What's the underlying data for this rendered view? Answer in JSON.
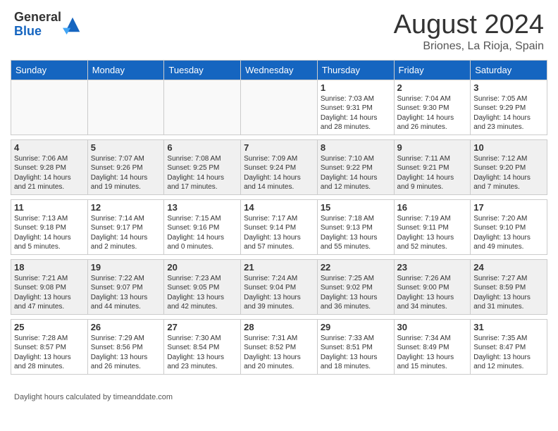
{
  "header": {
    "logo_general": "General",
    "logo_blue": "Blue",
    "title": "August 2024",
    "subtitle": "Briones, La Rioja, Spain"
  },
  "days_of_week": [
    "Sunday",
    "Monday",
    "Tuesday",
    "Wednesday",
    "Thursday",
    "Friday",
    "Saturday"
  ],
  "weeks": [
    {
      "days": [
        {
          "num": "",
          "info": "",
          "empty": true
        },
        {
          "num": "",
          "info": "",
          "empty": true
        },
        {
          "num": "",
          "info": "",
          "empty": true
        },
        {
          "num": "",
          "info": "",
          "empty": true
        },
        {
          "num": "1",
          "info": "Sunrise: 7:03 AM\nSunset: 9:31 PM\nDaylight: 14 hours and 28 minutes.",
          "empty": false
        },
        {
          "num": "2",
          "info": "Sunrise: 7:04 AM\nSunset: 9:30 PM\nDaylight: 14 hours and 26 minutes.",
          "empty": false
        },
        {
          "num": "3",
          "info": "Sunrise: 7:05 AM\nSunset: 9:29 PM\nDaylight: 14 hours and 23 minutes.",
          "empty": false
        }
      ]
    },
    {
      "days": [
        {
          "num": "4",
          "info": "Sunrise: 7:06 AM\nSunset: 9:28 PM\nDaylight: 14 hours and 21 minutes.",
          "empty": false
        },
        {
          "num": "5",
          "info": "Sunrise: 7:07 AM\nSunset: 9:26 PM\nDaylight: 14 hours and 19 minutes.",
          "empty": false
        },
        {
          "num": "6",
          "info": "Sunrise: 7:08 AM\nSunset: 9:25 PM\nDaylight: 14 hours and 17 minutes.",
          "empty": false
        },
        {
          "num": "7",
          "info": "Sunrise: 7:09 AM\nSunset: 9:24 PM\nDaylight: 14 hours and 14 minutes.",
          "empty": false
        },
        {
          "num": "8",
          "info": "Sunrise: 7:10 AM\nSunset: 9:22 PM\nDaylight: 14 hours and 12 minutes.",
          "empty": false
        },
        {
          "num": "9",
          "info": "Sunrise: 7:11 AM\nSunset: 9:21 PM\nDaylight: 14 hours and 9 minutes.",
          "empty": false
        },
        {
          "num": "10",
          "info": "Sunrise: 7:12 AM\nSunset: 9:20 PM\nDaylight: 14 hours and 7 minutes.",
          "empty": false
        }
      ]
    },
    {
      "days": [
        {
          "num": "11",
          "info": "Sunrise: 7:13 AM\nSunset: 9:18 PM\nDaylight: 14 hours and 5 minutes.",
          "empty": false
        },
        {
          "num": "12",
          "info": "Sunrise: 7:14 AM\nSunset: 9:17 PM\nDaylight: 14 hours and 2 minutes.",
          "empty": false
        },
        {
          "num": "13",
          "info": "Sunrise: 7:15 AM\nSunset: 9:16 PM\nDaylight: 14 hours and 0 minutes.",
          "empty": false
        },
        {
          "num": "14",
          "info": "Sunrise: 7:17 AM\nSunset: 9:14 PM\nDaylight: 13 hours and 57 minutes.",
          "empty": false
        },
        {
          "num": "15",
          "info": "Sunrise: 7:18 AM\nSunset: 9:13 PM\nDaylight: 13 hours and 55 minutes.",
          "empty": false
        },
        {
          "num": "16",
          "info": "Sunrise: 7:19 AM\nSunset: 9:11 PM\nDaylight: 13 hours and 52 minutes.",
          "empty": false
        },
        {
          "num": "17",
          "info": "Sunrise: 7:20 AM\nSunset: 9:10 PM\nDaylight: 13 hours and 49 minutes.",
          "empty": false
        }
      ]
    },
    {
      "days": [
        {
          "num": "18",
          "info": "Sunrise: 7:21 AM\nSunset: 9:08 PM\nDaylight: 13 hours and 47 minutes.",
          "empty": false
        },
        {
          "num": "19",
          "info": "Sunrise: 7:22 AM\nSunset: 9:07 PM\nDaylight: 13 hours and 44 minutes.",
          "empty": false
        },
        {
          "num": "20",
          "info": "Sunrise: 7:23 AM\nSunset: 9:05 PM\nDaylight: 13 hours and 42 minutes.",
          "empty": false
        },
        {
          "num": "21",
          "info": "Sunrise: 7:24 AM\nSunset: 9:04 PM\nDaylight: 13 hours and 39 minutes.",
          "empty": false
        },
        {
          "num": "22",
          "info": "Sunrise: 7:25 AM\nSunset: 9:02 PM\nDaylight: 13 hours and 36 minutes.",
          "empty": false
        },
        {
          "num": "23",
          "info": "Sunrise: 7:26 AM\nSunset: 9:00 PM\nDaylight: 13 hours and 34 minutes.",
          "empty": false
        },
        {
          "num": "24",
          "info": "Sunrise: 7:27 AM\nSunset: 8:59 PM\nDaylight: 13 hours and 31 minutes.",
          "empty": false
        }
      ]
    },
    {
      "days": [
        {
          "num": "25",
          "info": "Sunrise: 7:28 AM\nSunset: 8:57 PM\nDaylight: 13 hours and 28 minutes.",
          "empty": false
        },
        {
          "num": "26",
          "info": "Sunrise: 7:29 AM\nSunset: 8:56 PM\nDaylight: 13 hours and 26 minutes.",
          "empty": false
        },
        {
          "num": "27",
          "info": "Sunrise: 7:30 AM\nSunset: 8:54 PM\nDaylight: 13 hours and 23 minutes.",
          "empty": false
        },
        {
          "num": "28",
          "info": "Sunrise: 7:31 AM\nSunset: 8:52 PM\nDaylight: 13 hours and 20 minutes.",
          "empty": false
        },
        {
          "num": "29",
          "info": "Sunrise: 7:33 AM\nSunset: 8:51 PM\nDaylight: 13 hours and 18 minutes.",
          "empty": false
        },
        {
          "num": "30",
          "info": "Sunrise: 7:34 AM\nSunset: 8:49 PM\nDaylight: 13 hours and 15 minutes.",
          "empty": false
        },
        {
          "num": "31",
          "info": "Sunrise: 7:35 AM\nSunset: 8:47 PM\nDaylight: 13 hours and 12 minutes.",
          "empty": false
        }
      ]
    }
  ],
  "footer": {
    "daylight_label": "Daylight hours"
  }
}
